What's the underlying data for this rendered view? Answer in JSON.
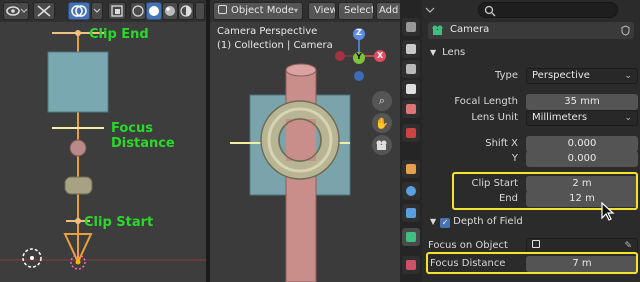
{
  "left_viewport": {
    "labels": {
      "clip_end": "Clip End",
      "focus_distance": "Focus Distance",
      "clip_start": "Clip Start"
    },
    "header_icons": [
      "eye-icon",
      "transform-icon",
      "overlay-icon",
      "xray-icon",
      "wireframe-shading-icon",
      "solid-shading-icon",
      "material-shading-icon",
      "rendered-shading-icon"
    ],
    "colors": {
      "label_green": "#29d829",
      "camera_orange": "#e8a03a"
    }
  },
  "middle_viewport": {
    "mode": "Object Mode",
    "menu": [
      "View",
      "Select",
      "Add"
    ],
    "info_line_1": "Camera Perspective",
    "info_line_2": "(1) Collection | Camera",
    "gizmo": {
      "z": "Z",
      "y": "Y",
      "x": "X"
    }
  },
  "properties": {
    "search_value": "",
    "object_name": "Camera",
    "lens_section": "Lens",
    "type_label": "Type",
    "type_value": "Perspective",
    "focal_length_label": "Focal Length",
    "focal_length_value": "35 mm",
    "lens_unit_label": "Lens Unit",
    "lens_unit_value": "Millimeters",
    "shift_x_label": "Shift X",
    "shift_x_value": "0.000",
    "shift_y_label": "Y",
    "shift_y_value": "0.000",
    "clip_start_label": "Clip Start",
    "clip_start_value": "2 m",
    "clip_end_label": "End",
    "clip_end_value": "12 m",
    "dof_section": "Depth of Field",
    "dof_enabled": true,
    "focus_object_label": "Focus on Object",
    "focus_object_value": "",
    "focus_distance_label": "Focus Distance",
    "focus_distance_value": "7 m",
    "colors": {
      "highlight": "#f5e22e",
      "accent": "#4772b3"
    }
  }
}
